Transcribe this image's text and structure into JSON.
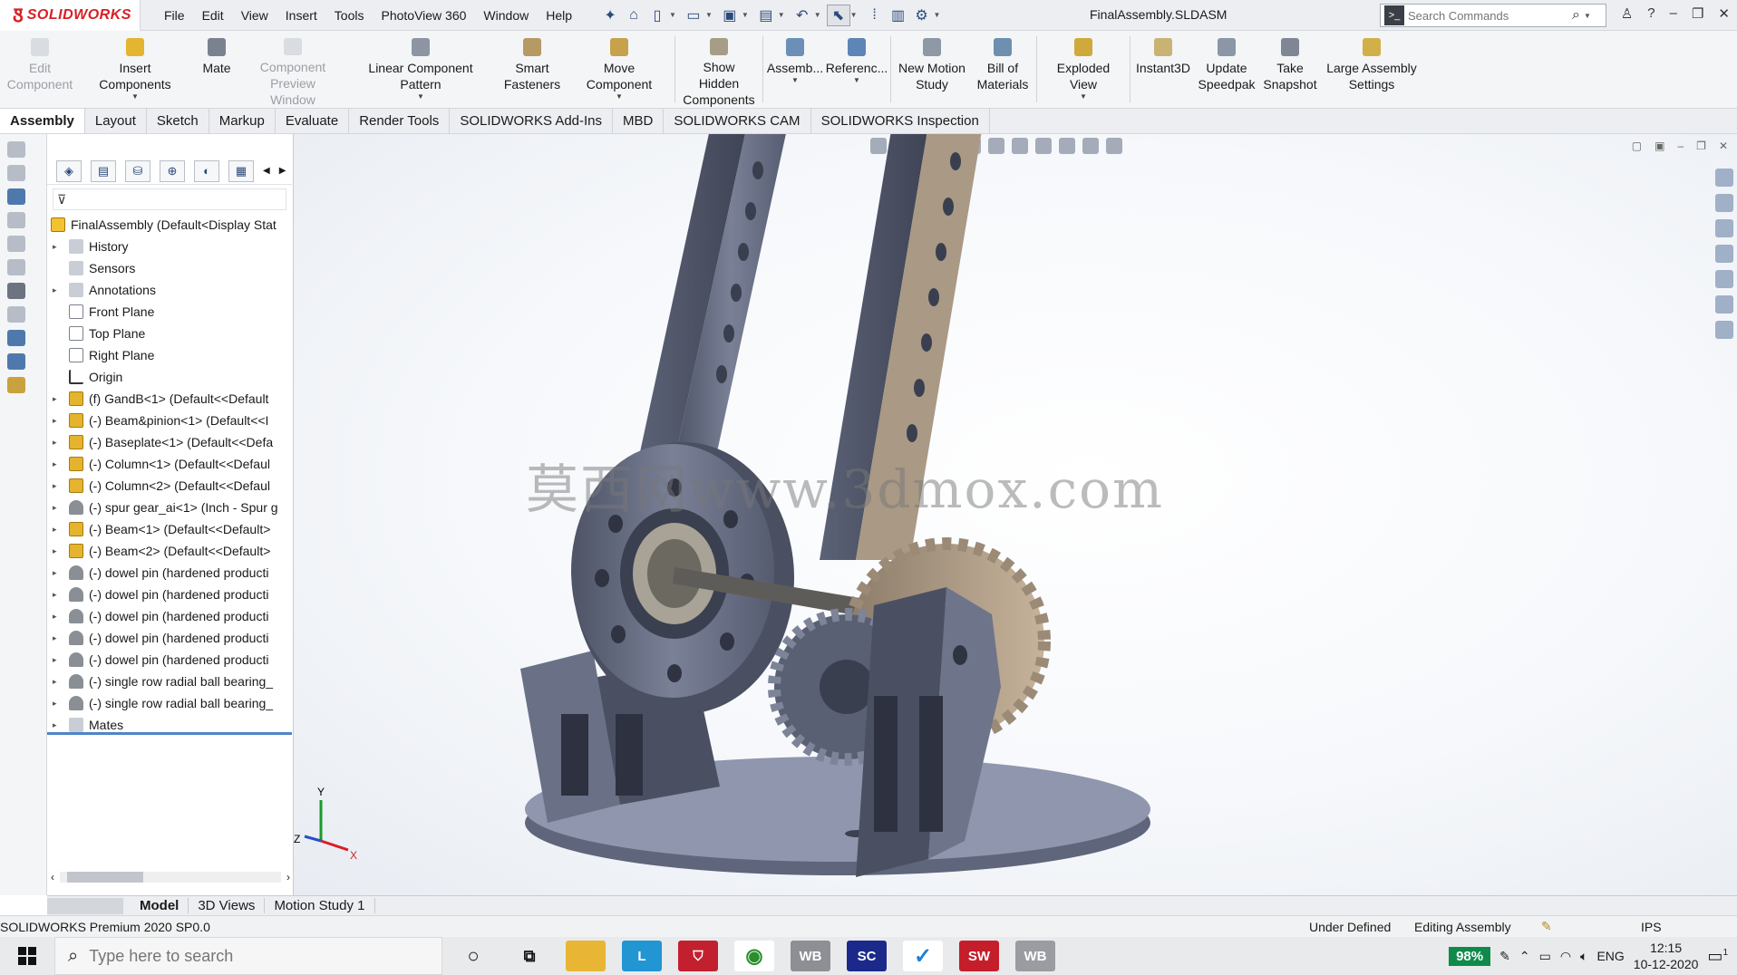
{
  "app": {
    "brand": "SOLIDWORKS",
    "doc_title": "FinalAssembly.SLDASM"
  },
  "menu": [
    "File",
    "Edit",
    "View",
    "Insert",
    "Tools",
    "PhotoView 360",
    "Window",
    "Help"
  ],
  "search": {
    "placeholder": "Search Commands"
  },
  "commands": [
    {
      "label": "Edit Component",
      "disabled": true
    },
    {
      "label": "Insert Components",
      "disabled": false
    },
    {
      "label": "Mate",
      "disabled": false
    },
    {
      "label": "Component Preview Window",
      "disabled": true
    },
    {
      "label": "Linear Component Pattern",
      "disabled": false
    },
    {
      "label": "Smart Fasteners",
      "disabled": false
    },
    {
      "label": "Move Component",
      "disabled": false
    },
    {
      "label": "Show Hidden Components",
      "disabled": false
    },
    {
      "label": "Assemb...",
      "disabled": false
    },
    {
      "label": "Referenc...",
      "disabled": false
    },
    {
      "label": "New Motion Study",
      "disabled": false
    },
    {
      "label": "Bill of Materials",
      "disabled": false
    },
    {
      "label": "Exploded View",
      "disabled": false
    },
    {
      "label": "Instant3D",
      "disabled": false
    },
    {
      "label": "Update Speedpak",
      "disabled": false
    },
    {
      "label": "Take Snapshot",
      "disabled": false
    },
    {
      "label": "Large Assembly Settings",
      "disabled": false
    }
  ],
  "tabs": [
    "Assembly",
    "Layout",
    "Sketch",
    "Markup",
    "Evaluate",
    "Render Tools",
    "SOLIDWORKS Add-Ins",
    "MBD",
    "SOLIDWORKS CAM",
    "SOLIDWORKS Inspection"
  ],
  "tree": {
    "root": "FinalAssembly  (Default<Display Stat",
    "items": [
      {
        "label": "History",
        "icon": "history-icon"
      },
      {
        "label": "Sensors",
        "icon": "sensors-icon"
      },
      {
        "label": "Annotations",
        "icon": "annotations-icon"
      },
      {
        "label": "Front Plane",
        "icon": "plane-icon"
      },
      {
        "label": "Top Plane",
        "icon": "plane-icon"
      },
      {
        "label": "Right Plane",
        "icon": "plane-icon"
      },
      {
        "label": "Origin",
        "icon": "origin-icon"
      },
      {
        "label": "(f) GandB<1> (Default<<Default",
        "icon": "part-icon"
      },
      {
        "label": "(-) Beam&pinion<1> (Default<<I",
        "icon": "part-icon"
      },
      {
        "label": "(-) Baseplate<1> (Default<<Defa",
        "icon": "part-icon"
      },
      {
        "label": "(-) Column<1> (Default<<Defaul",
        "icon": "part-icon"
      },
      {
        "label": "(-) Column<2> (Default<<Defaul",
        "icon": "part-icon"
      },
      {
        "label": "(-) spur gear_ai<1> (Inch - Spur g",
        "icon": "toolbox-part-icon"
      },
      {
        "label": "(-) Beam<1> (Default<<Default>",
        "icon": "part-icon"
      },
      {
        "label": "(-) Beam<2> (Default<<Default>",
        "icon": "part-icon"
      },
      {
        "label": "(-) dowel pin (hardened producti",
        "icon": "toolbox-part-icon"
      },
      {
        "label": "(-) dowel pin (hardened producti",
        "icon": "toolbox-part-icon"
      },
      {
        "label": "(-) dowel pin (hardened producti",
        "icon": "toolbox-part-icon"
      },
      {
        "label": "(-) dowel pin (hardened producti",
        "icon": "toolbox-part-icon"
      },
      {
        "label": "(-) dowel pin (hardened producti",
        "icon": "toolbox-part-icon"
      },
      {
        "label": "(-) single row radial ball bearing_",
        "icon": "toolbox-part-icon"
      },
      {
        "label": "(-) single row radial ball bearing_",
        "icon": "toolbox-part-icon"
      },
      {
        "label": "Mates",
        "icon": "mates-icon"
      }
    ]
  },
  "watermark": "莫西网www.3dmox.com",
  "triad": {
    "x": "X",
    "y": "Y",
    "z": "Z"
  },
  "bottom_tabs": [
    "Model",
    "3D Views",
    "Motion Study 1"
  ],
  "status": {
    "version": "SOLIDWORKS Premium 2020 SP0.0",
    "state": "Under Defined",
    "mode": "Editing Assembly",
    "units": "IPS"
  },
  "taskbar": {
    "search_placeholder": "Type here to search",
    "apps": [
      "L",
      "WB",
      "SC",
      "SW",
      "WB"
    ],
    "battery": "98%",
    "lang": "ENG",
    "time": "12:15",
    "date": "10-12-2020",
    "notifications": "1"
  },
  "colors": {
    "brand_red": "#d81f26",
    "part_steel": "#6e7488",
    "gear_bronze": "#b9a58f",
    "panel_blue": "#4d86c6"
  }
}
